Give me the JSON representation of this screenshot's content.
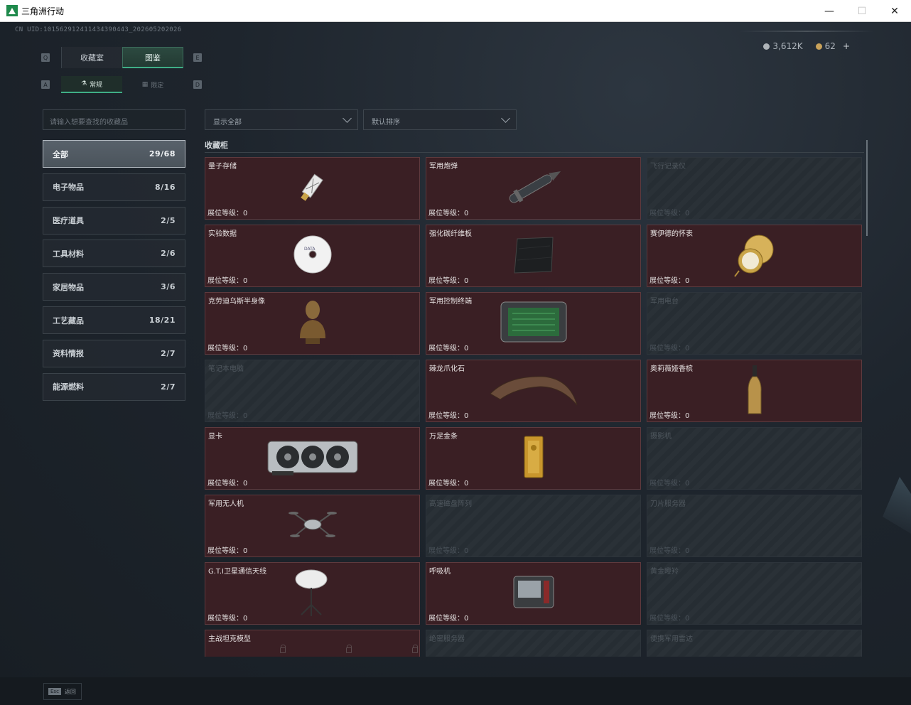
{
  "window": {
    "title": "三角洲行动"
  },
  "header": {
    "uid": "CN UID:101562912411434390443_202605202026",
    "currency": [
      {
        "icon": "silver-coin-icon",
        "value": "3,612K"
      },
      {
        "icon": "gold-coin-icon",
        "value": "62"
      }
    ],
    "plus": "+"
  },
  "tabs": {
    "items": [
      "收藏室",
      "图鉴"
    ],
    "active": "图鉴",
    "hint_left": "Q",
    "hint_right": "E"
  },
  "subtabs": {
    "items": [
      "常规",
      "限定"
    ],
    "active": "常规",
    "hint_left": "A",
    "hint_right": "D"
  },
  "search": {
    "placeholder": "请输入想要查找的收藏品"
  },
  "categories": [
    {
      "label": "全部",
      "count": "29/68",
      "active": true
    },
    {
      "label": "电子物品",
      "count": "8/16"
    },
    {
      "label": "医疗道具",
      "count": "2/5"
    },
    {
      "label": "工具材料",
      "count": "2/6"
    },
    {
      "label": "家居物品",
      "count": "3/6"
    },
    {
      "label": "工艺藏品",
      "count": "18/21"
    },
    {
      "label": "资料情报",
      "count": "2/7"
    },
    {
      "label": "能源燃料",
      "count": "2/7"
    }
  ],
  "filters": {
    "show": "显示全部",
    "sort": "默认排序"
  },
  "section": {
    "title": "收藏柜"
  },
  "level_label": "展位等级：0",
  "items": [
    {
      "name": "量子存储",
      "locked": false,
      "art": "usb"
    },
    {
      "name": "军用炮弹",
      "locked": false,
      "art": "shell"
    },
    {
      "name": "飞行记录仪",
      "locked": true
    },
    {
      "name": "实验数据",
      "locked": false,
      "art": "disc"
    },
    {
      "name": "强化碳纤维板",
      "locked": false,
      "art": "plate"
    },
    {
      "name": "赛伊德的怀表",
      "locked": false,
      "art": "watch"
    },
    {
      "name": "克劳迪乌斯半身像",
      "locked": false,
      "art": "bust"
    },
    {
      "name": "军用控制终端",
      "locked": false,
      "art": "terminal"
    },
    {
      "name": "军用电台",
      "locked": true
    },
    {
      "name": "笔记本电脑",
      "locked": true
    },
    {
      "name": "棘龙爪化石",
      "locked": false,
      "art": "claw"
    },
    {
      "name": "奥莉薇娅香槟",
      "locked": false,
      "art": "bottle"
    },
    {
      "name": "显卡",
      "locked": false,
      "art": "gpu"
    },
    {
      "name": "万足金条",
      "locked": false,
      "art": "gold"
    },
    {
      "name": "摄影机",
      "locked": true
    },
    {
      "name": "军用无人机",
      "locked": false,
      "art": "drone"
    },
    {
      "name": "高速磁盘阵列",
      "locked": true
    },
    {
      "name": "刀片服务器",
      "locked": true
    },
    {
      "name": "G.T.I卫星通信天线",
      "locked": false,
      "art": "dish"
    },
    {
      "name": "呼吸机",
      "locked": false,
      "art": "ventilator"
    },
    {
      "name": "黄金瞪羚",
      "locked": true
    },
    {
      "name": "主战坦克模型",
      "locked": false,
      "art": "tank"
    },
    {
      "name": "绝密服务器",
      "locked": true
    },
    {
      "name": "便携军用雷达",
      "locked": true
    }
  ],
  "footer": {
    "key": "Esc",
    "label": "返回"
  },
  "colors": {
    "accent": "#3fae86",
    "card_bg": "#3a1f24",
    "locked_bg": "#262d33"
  }
}
